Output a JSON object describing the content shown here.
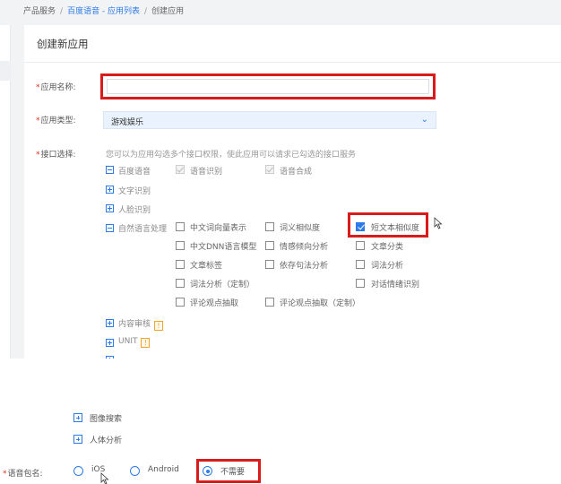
{
  "breadcrumb": {
    "root": "产品服务",
    "sep": "/",
    "parent": "百度语音 - 应用列表",
    "current": "创建应用"
  },
  "panel": {
    "title": "创建新应用"
  },
  "form": {
    "name": {
      "label": "应用名称:",
      "value": ""
    },
    "type": {
      "label": "应用类型:",
      "value": "游戏娱乐"
    },
    "api": {
      "label": "接口选择:",
      "hint": "您可以为应用勾选多个接口权限，使此应用可以请求已勾选的接口服务",
      "groups": [
        {
          "name": "百度语音",
          "expanded": true
        },
        {
          "name": "文字识别",
          "expanded": false
        },
        {
          "name": "人脸识别",
          "expanded": false
        },
        {
          "name": "自然语言处理",
          "expanded": true
        },
        {
          "name": "内容审核",
          "expanded": false,
          "badge": "!"
        },
        {
          "name": "UNIT",
          "expanded": false,
          "badge": "!"
        }
      ],
      "speech_items": [
        "语音识别",
        "语音合成"
      ],
      "nlp_items": [
        [
          "中文词向量表示",
          "词义相似度",
          "短文本相似度"
        ],
        [
          "中文DNN语言模型",
          "情感倾向分析",
          "文章分类"
        ],
        [
          "文章标签",
          "依存句法分析",
          "词法分析"
        ],
        [
          "词法分析（定制）",
          "",
          "对话情绪识别"
        ],
        [
          "评论观点抽取",
          "评论观点抽取（定制）",
          ""
        ]
      ],
      "checked_item": "短文本相似度"
    }
  },
  "lower": {
    "groups": [
      "图像搜索",
      "人体分析"
    ],
    "package": {
      "label": "语音包名:",
      "options": [
        "iOS",
        "Android",
        "不需要"
      ],
      "selected": "不需要"
    }
  },
  "colors": {
    "accent": "#2d7bea",
    "highlight": "#d91b1b",
    "required": "#e0301e",
    "warning": "#f0a52e"
  }
}
